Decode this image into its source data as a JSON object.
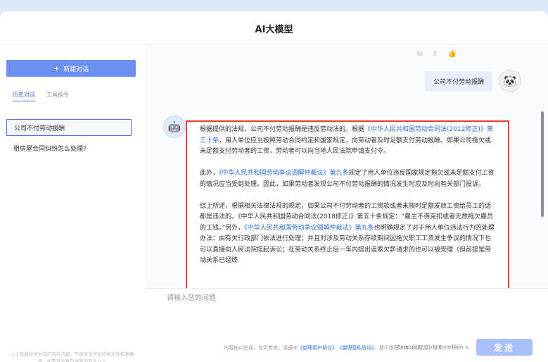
{
  "header": {
    "title": "AI大模型"
  },
  "sidebar": {
    "new_chat_label": "新建对话",
    "tabs": [
      {
        "label": "历史对话"
      },
      {
        "label": "工具指令"
      }
    ],
    "conversations": [
      {
        "label": "公司不付劳动报酬"
      },
      {
        "label": "租房屋合同纠纷怎么处理?"
      }
    ],
    "disclaimer": "人工智能技术生成的回答内容，不能保证信息的真实性和准确性，如需专业意见请咨询专业人士"
  },
  "chat": {
    "user_message": "公司不付劳动报酬",
    "answer": {
      "p1_a": "根据提供的法规，公司不付劳动报酬是违反劳动法的。根据",
      "p1_link": "《中华人民共和国劳动合同法(2012修正)》第三十条",
      "p1_b": "，用人单位应当按照劳动合同约定和国家规定，向劳动者及时足额支付劳动报酬。如果公司拖欠或未足额支付劳动者的工资，劳动者可以向当地人民法院申请支付令。",
      "p2_a": "此外，",
      "p2_link": "《中华人民共和国劳动争议调解仲裁法》第九条",
      "p2_b": "规定了用人单位违反国家规定拖欠或未足额支付工资的情况应当受到处理。因此，如果劳动者发现公司不付劳动报酬的情况发生时应及时向有关部门投诉。",
      "p3_a": "综上所述，根据相关法律法规的规定，如果公司不付劳动者的工资款或者未按时足额发放工资给员工的话都是违法的。《中华人民共和国劳动合同法(2018修正)》第五十条规定：“雇主不得克扣或者无故拖欠雇员的工钱。”另外，",
      "p3_link": "《中华人民共和国劳动争议调解仲裁法》第九条",
      "p3_b": "也明确规定了对于用人单位违法行为的处理办法：由有关行政部门依法进行处理；并且对涉及劳动关系存续期间因拖欠职工工资发生争议的情况下也可以直接向人民法院提起诉讼；在劳动关系终止后一年内提出追索欠薪请求的也可以被受理（但前提是劳动关系已经终"
    }
  },
  "input": {
    "placeholder": "请输入您的问题",
    "hint": "Enter发送，Ctrl+Enter换行",
    "send_label": "发送"
  },
  "footer": {
    "prefix": "内容由AI生成，仅供参考，请遵守",
    "link1": "《御理用户协议》",
    "sep": "、",
    "link2": "《御理隐私协议》",
    "suffix": "，基于御理法律AI大模型，版本：V1.0.5.0"
  },
  "colors": {
    "accent": "#6a8ff0",
    "link": "#2f6fd8",
    "highlight_border": "#e53935",
    "send_button": "#a9c1f7"
  }
}
